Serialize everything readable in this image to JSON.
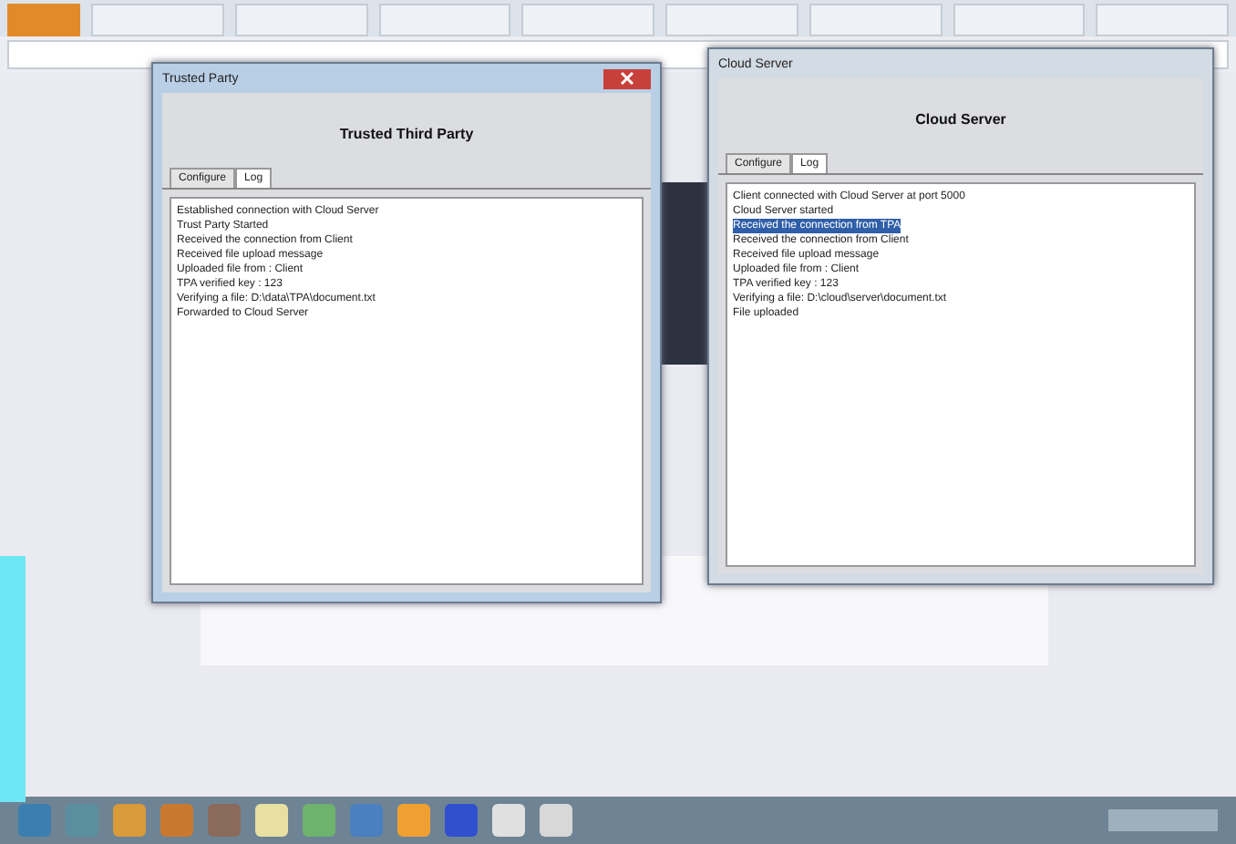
{
  "windows": [
    {
      "title": "Trusted Party",
      "heading": "Trusted Third Party",
      "tabs": [
        {
          "label": "Configure",
          "selected": false
        },
        {
          "label": "Log",
          "selected": true
        }
      ],
      "log": [
        {
          "text": "Established connection with Cloud Server",
          "selected": false
        },
        {
          "text": "Trust Party Started",
          "selected": false
        },
        {
          "text": "Received the connection from Client",
          "selected": false
        },
        {
          "text": "Received file upload message",
          "selected": false
        },
        {
          "text": "Uploaded file from : Client",
          "selected": false
        },
        {
          "text": "TPA verified key : 123",
          "selected": false
        },
        {
          "text": "Verifying a file: D:\\data\\TPA\\document.txt",
          "selected": false
        },
        {
          "text": "Forwarded to Cloud Server",
          "selected": false
        }
      ]
    },
    {
      "title": "Cloud Server",
      "heading": "Cloud Server",
      "tabs": [
        {
          "label": "Configure",
          "selected": false
        },
        {
          "label": "Log",
          "selected": true
        }
      ],
      "log": [
        {
          "text": "Client connected with Cloud Server at port 5000",
          "selected": false
        },
        {
          "text": "Cloud Server started",
          "selected": false
        },
        {
          "text": "Received the connection from TPA",
          "selected": true
        },
        {
          "text": "Received the connection from Client",
          "selected": false
        },
        {
          "text": "Received file upload message",
          "selected": false
        },
        {
          "text": "Uploaded file from : Client",
          "selected": false
        },
        {
          "text": "TPA verified key : 123",
          "selected": false
        },
        {
          "text": "Verifying a file: D:\\cloud\\server\\document.txt",
          "selected": false
        },
        {
          "text": "File uploaded",
          "selected": false
        }
      ]
    }
  ]
}
